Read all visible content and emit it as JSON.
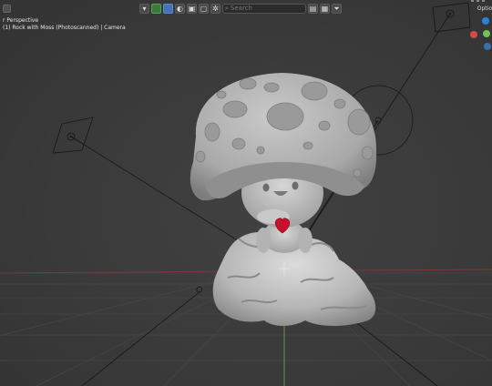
{
  "viewport": {
    "overlay": {
      "line1": "r Perspective",
      "line2": "(1) Rock with Moss (Photoscanned) | Camera"
    },
    "options_label": "Optio",
    "search": {
      "placeholder": "Search"
    },
    "toolbar_icons": [
      "dropdown-icon",
      "green-dot-icon",
      "blue-square-icon",
      "sphere-icon",
      "image-icon",
      "screen-icon",
      "gear-icon",
      "search-icon",
      "collapse-icon",
      "view-icon",
      "filter-icon"
    ],
    "gizmo_colors": {
      "z": "#2e7fd6",
      "y": "#6fc24b",
      "x": "#d34a4a",
      "neg": "#3b6fa8"
    },
    "heart_color": "#c8102e",
    "accent": "#4772b3"
  }
}
